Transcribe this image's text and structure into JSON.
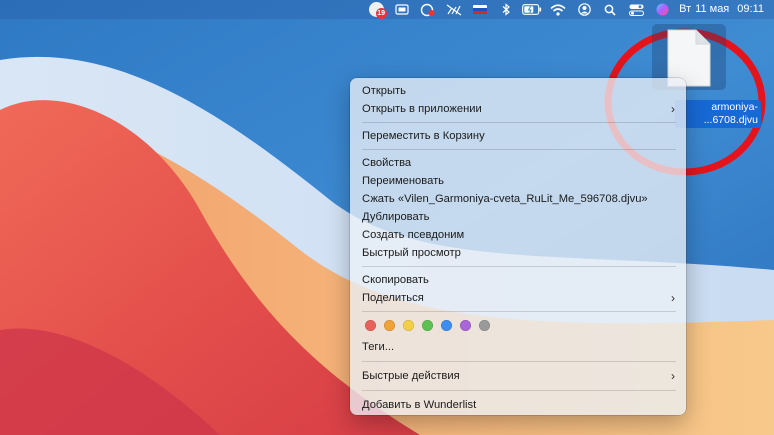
{
  "menubar": {
    "notification_badge": "19",
    "day": "Вт",
    "date": "11 мая",
    "time": "09:11",
    "icons": [
      "app-badge-icon",
      "display-icon",
      "cloud-sync-icon",
      "no-signal-icon",
      "russian-flag-icon",
      "bluetooth-icon",
      "battery-charging-icon",
      "wifi-icon",
      "user-icon",
      "search-icon",
      "control-center-icon",
      "siri-icon"
    ]
  },
  "file": {
    "label_line1": "armoniya-",
    "label_line2": "...6708.djvu",
    "icon": "document-icon"
  },
  "context_menu": {
    "open": "Открыть",
    "open_with": "Открыть в приложении",
    "move_to_trash": "Переместить в Корзину",
    "properties": "Свойства",
    "rename": "Переименовать",
    "compress": "Сжать «Vilen_Garmoniya-cveta_RuLit_Me_596708.djvu»",
    "duplicate": "Дублировать",
    "make_alias": "Создать псевдоним",
    "quick_look": "Быстрый просмотр",
    "copy": "Скопировать",
    "share": "Поделиться",
    "tags": "Теги...",
    "quick_actions": "Быстрые действия",
    "add_to_wunderlist": "Добавить в Wunderlist",
    "tag_colors": [
      "#e8625c",
      "#f0a23a",
      "#f3cf46",
      "#5dc151",
      "#3d8ef0",
      "#a866d6",
      "#9a9a9a"
    ]
  },
  "colors": {
    "annotation_ring": "#e5141c",
    "selection": "#1769d6"
  }
}
